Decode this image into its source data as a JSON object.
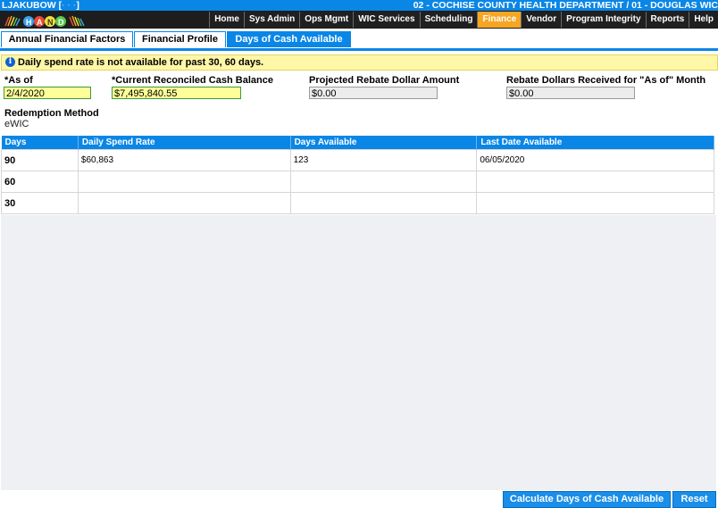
{
  "header": {
    "user": "LJAKUBOW",
    "user_bracket_open": "[",
    "user_bracket_close": "]",
    "user_redacted": "· · ·",
    "location": "02 - COCHISE COUNTY HEALTH DEPARTMENT / 01 - DOUGLAS WIC",
    "logo_text": "HANDS"
  },
  "nav": {
    "items": [
      {
        "label": "Home"
      },
      {
        "label": "Sys Admin"
      },
      {
        "label": "Ops Mgmt"
      },
      {
        "label": "WIC Services"
      },
      {
        "label": "Scheduling"
      },
      {
        "label": "Finance"
      },
      {
        "label": "Vendor"
      },
      {
        "label": "Program Integrity"
      },
      {
        "label": "Reports"
      },
      {
        "label": "Help"
      }
    ],
    "active": "Finance"
  },
  "tabs": [
    {
      "label": "Annual Financial Factors"
    },
    {
      "label": "Financial Profile"
    },
    {
      "label": "Days of Cash Available"
    }
  ],
  "info": {
    "message": "Daily spend rate is not available for past 30, 60 days."
  },
  "form": {
    "as_of_label": "*As of",
    "as_of_value": "2/4/2020",
    "balance_label": "*Current Reconciled Cash Balance",
    "balance_value": "$7,495,840.55",
    "rebate_projected_label": "Projected Rebate Dollar Amount",
    "rebate_projected_value": "$0.00",
    "rebate_received_label": "Rebate Dollars Received for \"As of\" Month",
    "rebate_received_value": "$0.00",
    "redemption_label": "Redemption Method",
    "redemption_value": "eWIC"
  },
  "grid": {
    "columns": [
      "Days",
      "Daily Spend Rate",
      "Days Available",
      "Last Date Available"
    ],
    "rows": [
      {
        "days": "90",
        "rate": "$60,863",
        "available": "123",
        "last_date": "06/05/2020"
      },
      {
        "days": "60",
        "rate": "",
        "available": "",
        "last_date": ""
      },
      {
        "days": "30",
        "rate": "",
        "available": "",
        "last_date": ""
      }
    ]
  },
  "buttons": {
    "calculate": "Calculate Days of Cash Available",
    "reset": "Reset"
  },
  "colors": {
    "brand_blue": "#0a86e6",
    "active_orange": "#f5a623",
    "info_yellow": "#fff7a8",
    "required_field": "#ffff99"
  }
}
